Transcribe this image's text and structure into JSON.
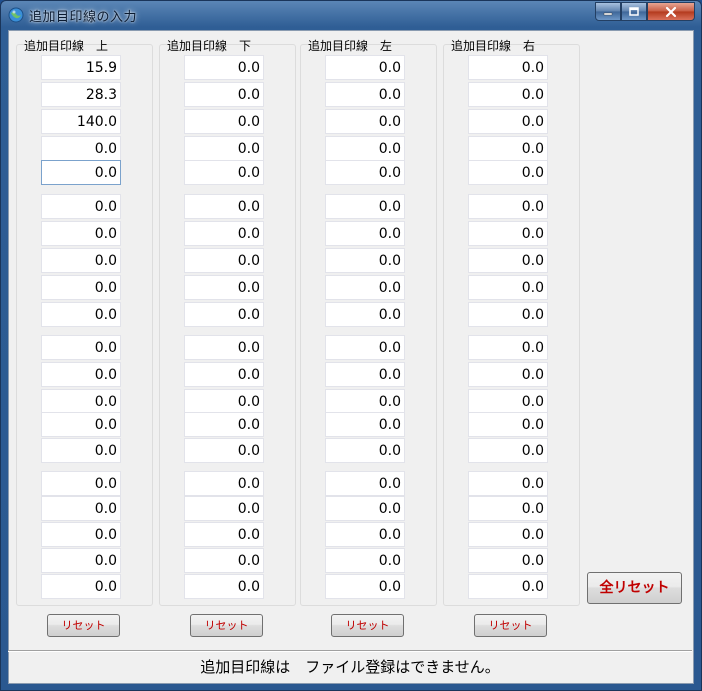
{
  "window": {
    "title": "追加目印線の入力"
  },
  "columns": [
    {
      "label": "追加目印線　上",
      "values": [
        "15.9",
        "28.3",
        "140.0",
        "0.0",
        "0.0",
        "0.0",
        "0.0",
        "0.0",
        "0.0",
        "0.0",
        "0.0",
        "0.0",
        "0.0",
        "0.0",
        "0.0",
        "0.0",
        "0.0",
        "0.0",
        "0.0",
        "0.0"
      ],
      "reset_label": "リセット"
    },
    {
      "label": "追加目印線　下",
      "values": [
        "0.0",
        "0.0",
        "0.0",
        "0.0",
        "0.0",
        "0.0",
        "0.0",
        "0.0",
        "0.0",
        "0.0",
        "0.0",
        "0.0",
        "0.0",
        "0.0",
        "0.0",
        "0.0",
        "0.0",
        "0.0",
        "0.0",
        "0.0"
      ],
      "reset_label": "リセット"
    },
    {
      "label": "追加目印線　左",
      "values": [
        "0.0",
        "0.0",
        "0.0",
        "0.0",
        "0.0",
        "0.0",
        "0.0",
        "0.0",
        "0.0",
        "0.0",
        "0.0",
        "0.0",
        "0.0",
        "0.0",
        "0.0",
        "0.0",
        "0.0",
        "0.0",
        "0.0",
        "0.0"
      ],
      "reset_label": "リセット"
    },
    {
      "label": "追加目印線　右",
      "values": [
        "0.0",
        "0.0",
        "0.0",
        "0.0",
        "0.0",
        "0.0",
        "0.0",
        "0.0",
        "0.0",
        "0.0",
        "0.0",
        "0.0",
        "0.0",
        "0.0",
        "0.0",
        "0.0",
        "0.0",
        "0.0",
        "0.0",
        "0.0"
      ],
      "reset_label": "リセット"
    }
  ],
  "all_reset_label": "全リセット",
  "status_message": "追加目印線は　ファイル登録はできません。",
  "focused_field": {
    "column": 0,
    "row": 4
  },
  "colors": {
    "reset_text": "#c00000",
    "title_bar": "#2f5e95"
  },
  "icons": {
    "app": "globe-icon",
    "minimize": "minimize-icon",
    "maximize": "maximize-icon",
    "close": "close-icon"
  }
}
